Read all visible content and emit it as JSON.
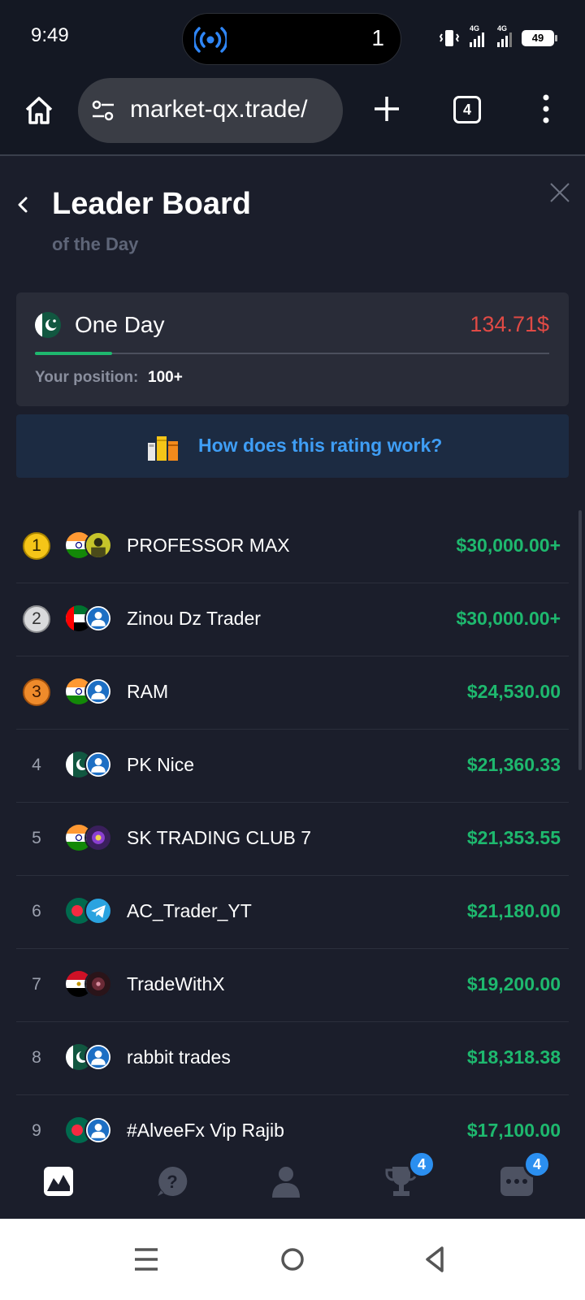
{
  "status_bar": {
    "time": "9:49",
    "hotspot_count": "1",
    "network_1": "4G",
    "network_2": "4G",
    "battery": "49"
  },
  "browser": {
    "url": "market-qx.trade/",
    "tab_count": "4"
  },
  "header": {
    "title": "Leader Board",
    "subtitle": "of the Day"
  },
  "day_card": {
    "label": "One Day",
    "amount": "134.71$",
    "progress_fraction": 0.15,
    "position_label": "Your position:",
    "position_value": "100+"
  },
  "rating_banner": {
    "text": "How does this rating work?"
  },
  "leaderboard": [
    {
      "rank": "1",
      "name": "PROFESSOR MAX",
      "amount": "$30,000.00+",
      "flag": "india",
      "avatar": "photo-yellow"
    },
    {
      "rank": "2",
      "name": "Zinou Dz Trader",
      "amount": "$30,000.00+",
      "flag": "uae",
      "avatar": "default-user"
    },
    {
      "rank": "3",
      "name": "RAM",
      "amount": "$24,530.00",
      "flag": "india",
      "avatar": "default-user"
    },
    {
      "rank": "4",
      "name": "PK Nice",
      "amount": "$21,360.33",
      "flag": "pakistan",
      "avatar": "default-user"
    },
    {
      "rank": "5",
      "name": "SK TRADING CLUB 7",
      "amount": "$21,353.55",
      "flag": "india",
      "avatar": "photo-purple"
    },
    {
      "rank": "6",
      "name": "AC_Trader_YT",
      "amount": "$21,180.00",
      "flag": "bangladesh",
      "avatar": "telegram"
    },
    {
      "rank": "7",
      "name": "TradeWithX",
      "amount": "$19,200.00",
      "flag": "egypt",
      "avatar": "photo-dark"
    },
    {
      "rank": "8",
      "name": "rabbit trades",
      "amount": "$18,318.38",
      "flag": "pakistan",
      "avatar": "default-user"
    },
    {
      "rank": "9",
      "name": "#AlveeFx Vip Rajib",
      "amount": "$17,100.00",
      "flag": "bangladesh",
      "avatar": "default-user"
    }
  ],
  "bottom_nav": {
    "trophy_badge": "4",
    "chat_badge": "4"
  },
  "colors": {
    "background": "#1b1e2b",
    "card": "#292c38",
    "accent_green": "#1eb86e",
    "accent_red": "#e04a45",
    "accent_blue": "#3f9ef5"
  }
}
